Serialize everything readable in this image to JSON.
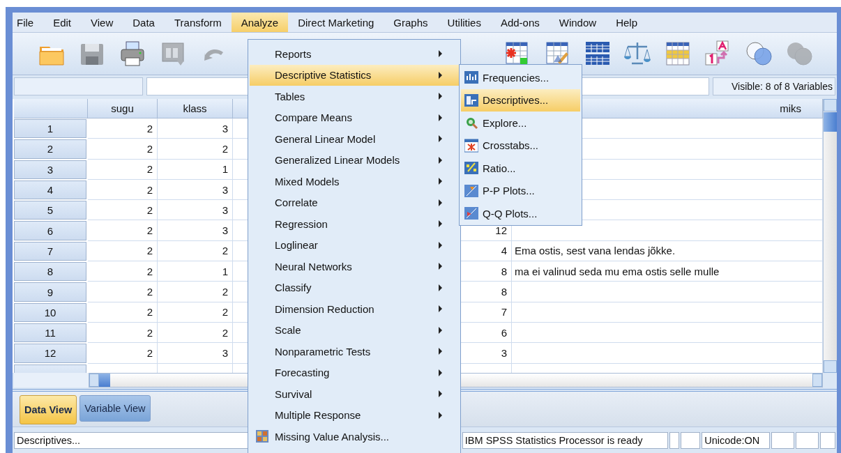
{
  "menubar": [
    {
      "label": "File",
      "selected": false
    },
    {
      "label": "Edit",
      "selected": false
    },
    {
      "label": "View",
      "selected": false
    },
    {
      "label": "Data",
      "selected": false
    },
    {
      "label": "Transform",
      "selected": false
    },
    {
      "label": "Analyze",
      "selected": true
    },
    {
      "label": "Direct Marketing",
      "selected": false
    },
    {
      "label": "Graphs",
      "selected": false
    },
    {
      "label": "Utilities",
      "selected": false
    },
    {
      "label": "Add-ons",
      "selected": false
    },
    {
      "label": "Window",
      "selected": false
    },
    {
      "label": "Help",
      "selected": false
    }
  ],
  "toolbar": [
    {
      "disabled": false
    },
    {
      "disabled": true
    },
    {
      "disabled": false
    },
    {
      "disabled": true
    },
    {
      "disabled": true
    },
    {
      "disabled": false
    },
    {
      "disabled": false
    },
    {
      "disabled": false
    },
    {
      "disabled": false
    },
    {
      "disabled": false
    },
    {
      "disabled": false
    },
    {
      "disabled": false
    },
    {
      "disabled": true
    }
  ],
  "cell_editor": {
    "visible_variables": "Visible: 8 of 8 Variables"
  },
  "grid": {
    "headers": {
      "sugu": "sugu",
      "klass": "klass",
      "miks": "miks"
    },
    "rows": [
      {
        "row": "1",
        "sugu": "2",
        "klass": "3"
      },
      {
        "row": "2",
        "sugu": "2",
        "klass": "2"
      },
      {
        "row": "3",
        "sugu": "2",
        "klass": "1"
      },
      {
        "row": "4",
        "sugu": "2",
        "klass": "3"
      },
      {
        "row": "5",
        "sugu": "2",
        "klass": "3"
      },
      {
        "row": "6",
        "sugu": "2",
        "klass": "3",
        "column_3": "12"
      },
      {
        "row": "7",
        "sugu": "2",
        "klass": "2",
        "column_3": "4",
        "miks": "Ema ostis, sest vana lendas jõkke."
      },
      {
        "row": "8",
        "sugu": "2",
        "klass": "1",
        "column_3": "8",
        "miks": "ma ei valinud seda mu ema ostis selle mulle"
      },
      {
        "row": "9",
        "sugu": "2",
        "klass": "2",
        "column_3": "8"
      },
      {
        "row": "10",
        "sugu": "2",
        "klass": "2",
        "column_3": "7"
      },
      {
        "row": "11",
        "sugu": "2",
        "klass": "2",
        "column_3": "6"
      },
      {
        "row": "12",
        "sugu": "2",
        "klass": "3",
        "column_3": "3"
      }
    ]
  },
  "view_tabs": [
    {
      "label": "Data View",
      "selected": true
    },
    {
      "label": "Variable View",
      "selected": false
    }
  ],
  "status_bar": {
    "message": "Descriptives...",
    "processor": "IBM SPSS Statistics Processor is ready",
    "unicode": "Unicode:ON"
  },
  "analyze_menu": [
    {
      "label": "Reports",
      "kind": "submenu",
      "selected": false
    },
    {
      "label": "Descriptive Statistics",
      "kind": "submenu",
      "selected": true
    },
    {
      "label": "Tables",
      "kind": "submenu",
      "selected": false
    },
    {
      "label": "Compare Means",
      "kind": "submenu",
      "selected": false
    },
    {
      "label": "General Linear Model",
      "kind": "submenu",
      "selected": false
    },
    {
      "label": "Generalized Linear Models",
      "kind": "submenu",
      "selected": false
    },
    {
      "label": "Mixed Models",
      "kind": "submenu",
      "selected": false
    },
    {
      "label": "Correlate",
      "kind": "submenu",
      "selected": false
    },
    {
      "label": "Regression",
      "kind": "submenu",
      "selected": false
    },
    {
      "label": "Loglinear",
      "kind": "submenu",
      "selected": false
    },
    {
      "label": "Neural Networks",
      "kind": "submenu",
      "selected": false
    },
    {
      "label": "Classify",
      "kind": "submenu",
      "selected": false
    },
    {
      "label": "Dimension Reduction",
      "kind": "submenu",
      "selected": false
    },
    {
      "label": "Scale",
      "kind": "submenu",
      "selected": false
    },
    {
      "label": "Nonparametric Tests",
      "kind": "submenu",
      "selected": false
    },
    {
      "label": "Forecasting",
      "kind": "submenu",
      "selected": false
    },
    {
      "label": "Survival",
      "kind": "submenu",
      "selected": false
    },
    {
      "label": "Multiple Response",
      "kind": "submenu",
      "selected": false
    },
    {
      "label": "Missing Value Analysis...",
      "kind": "command",
      "selected": false
    }
  ],
  "descriptive_statistics_menu": [
    {
      "label": "Frequencies...",
      "selected": false
    },
    {
      "label": "Descriptives...",
      "selected": true
    },
    {
      "label": "Explore...",
      "selected": false
    },
    {
      "label": "Crosstabs...",
      "selected": false
    },
    {
      "label": "Ratio...",
      "selected": false
    },
    {
      "label": "P-P Plots...",
      "selected": false
    },
    {
      "label": "Q-Q Plots...",
      "selected": false
    }
  ]
}
